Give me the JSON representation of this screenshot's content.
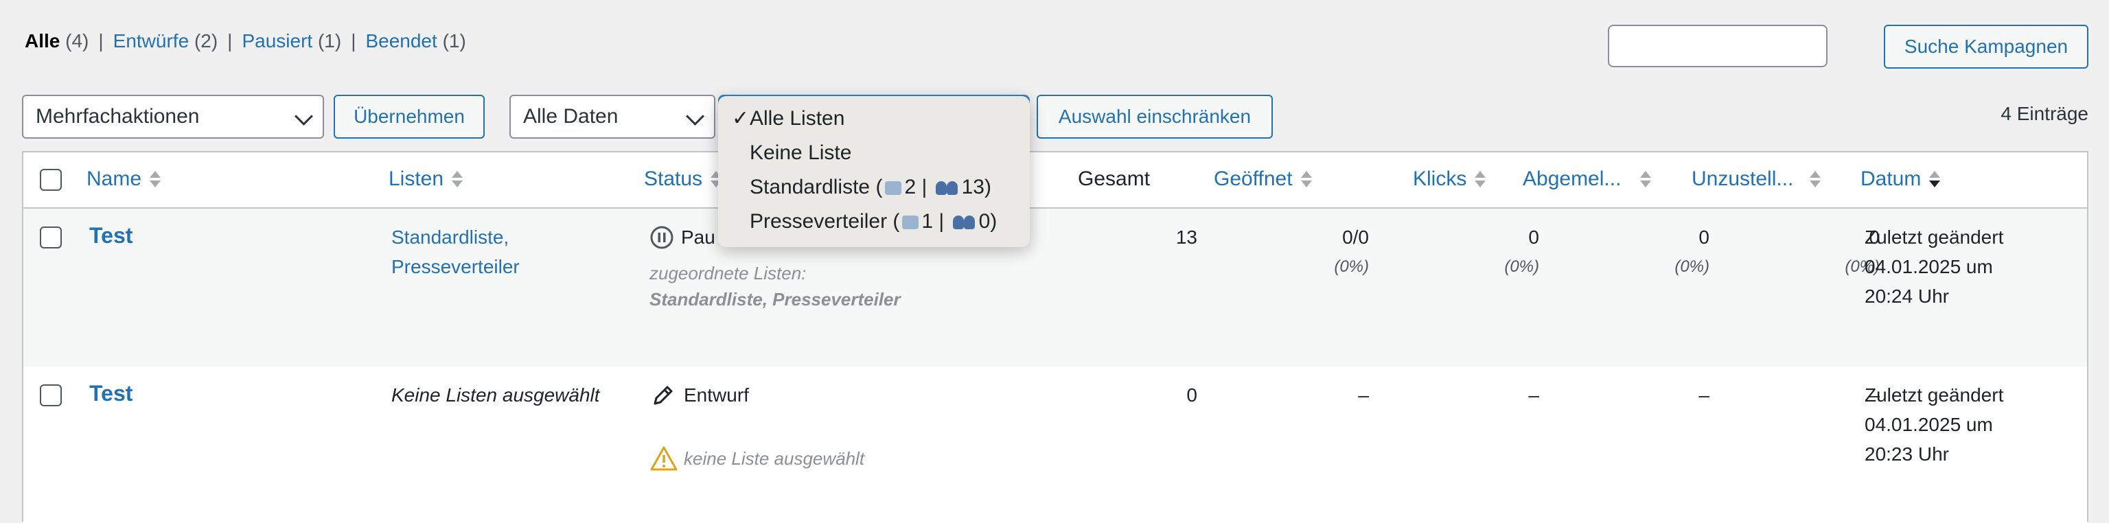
{
  "filters": [
    {
      "label": "Alle",
      "count": "(4)",
      "current": true
    },
    {
      "label": "Entwürfe",
      "count": "(2)",
      "current": false
    },
    {
      "label": "Pausiert",
      "count": "(1)",
      "current": false
    },
    {
      "label": "Beendet",
      "count": "(1)",
      "current": false
    }
  ],
  "search": {
    "value": "",
    "button": "Suche Kampagnen"
  },
  "bulk": {
    "selected": "Mehrfachaktionen",
    "apply": "Übernehmen"
  },
  "date_filter": {
    "selected": "Alle Daten"
  },
  "list_filter": {
    "options": [
      "Alle Listen",
      "Keine Liste",
      "Standardliste (",
      "Presseverteiler ("
    ],
    "std_a": "2 | ",
    "std_b": "13)",
    "press_a": "1 | ",
    "press_b": "0)",
    "check": "✓",
    "submit": "Auswahl einschränken"
  },
  "items_count": "4 Einträge",
  "columns": {
    "name": "Name",
    "lists": "Listen",
    "status": "Status",
    "total": "Gesamt",
    "opened": "Geöffnet",
    "clicks": "Klicks",
    "unsub": "Abgemel...",
    "bounce": "Unzustell...",
    "date": "Datum"
  },
  "rows": [
    {
      "name": "Test",
      "lists_line1": "Standardliste,",
      "lists_line2": "Presseverteiler",
      "status": "Pau",
      "status_note1": "zugeordnete Listen:",
      "status_note2": "Standardliste, Presseverteiler",
      "total": "13",
      "opened": "0/0",
      "opened_pct": "(0%)",
      "clicks": "0",
      "clicks_pct": "(0%)",
      "unsub": "0",
      "unsub_pct": "(0%)",
      "bounce": "0",
      "bounce_pct": "(0%)",
      "date1": "Zuletzt geändert",
      "date2": "04.01.2025 um",
      "date3": "20:24 Uhr"
    },
    {
      "name": "Test",
      "lists_line1": "Keine Listen ausgewählt",
      "status": "Entwurf",
      "status_note1": "keine Liste ausgewählt",
      "total": "0",
      "opened": "–",
      "clicks": "–",
      "unsub": "–",
      "bounce": "–",
      "date1": "Zuletzt geändert",
      "date2": "04.01.2025 um",
      "date3": "20:23 Uhr"
    }
  ],
  "colors": {
    "link": "#2271b1",
    "warning": "#dba617"
  }
}
